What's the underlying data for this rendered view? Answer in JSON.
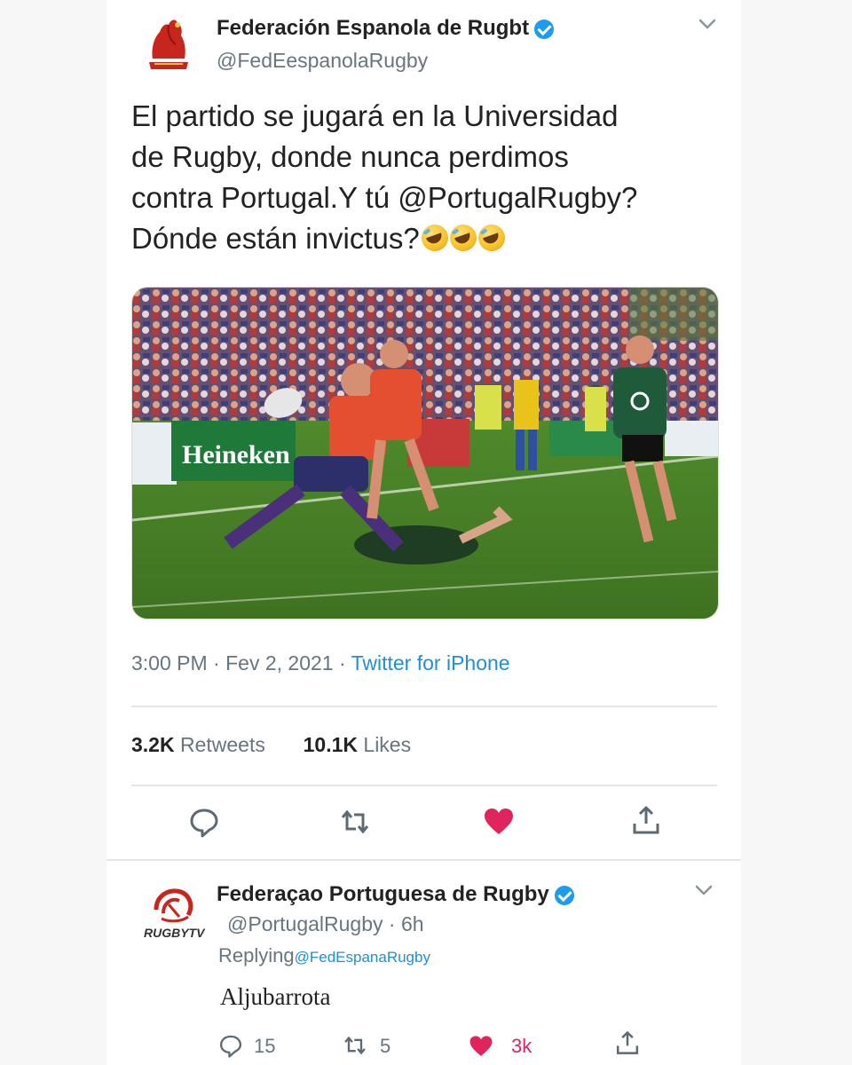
{
  "tweet": {
    "author_name": "Federación Espanola de Rugbt",
    "author_handle": "@FedEespanolaRugby",
    "text_lines": [
      "El partido se jugará en la Universidad",
      "de Rugby, donde nunca perdimos",
      "contra Portugal.Y tú @PortugalRugby?",
      "Dónde están invictus?"
    ],
    "emojis": [
      "rolling-on-floor-laughing",
      "rolling-on-floor-laughing",
      "rolling-on-floor-laughing"
    ],
    "photo_sign": "Heineken",
    "time": "3:00 PM",
    "date": "Fev 2, 2021",
    "source": "Twitter for iPhone",
    "retweets_count": "3.2K",
    "retweets_label": "Retweets",
    "likes_count": "10.1K",
    "likes_label": "Likes"
  },
  "reply": {
    "author_name": "Federaçao Portuguesa de Rugby",
    "author_handle": "@PortugalRugby",
    "age": "6h",
    "replying_label": "Replying",
    "replying_to": "@FedEspanaRugby",
    "logo_text": "RUGBYTV",
    "text": "Aljubarrota",
    "reply_count": "15",
    "retweet_count": "5",
    "like_count": "3k"
  },
  "colors": {
    "accent_blue": "#1d8fdc",
    "like_red": "#e0245e",
    "muted": "#667580"
  }
}
